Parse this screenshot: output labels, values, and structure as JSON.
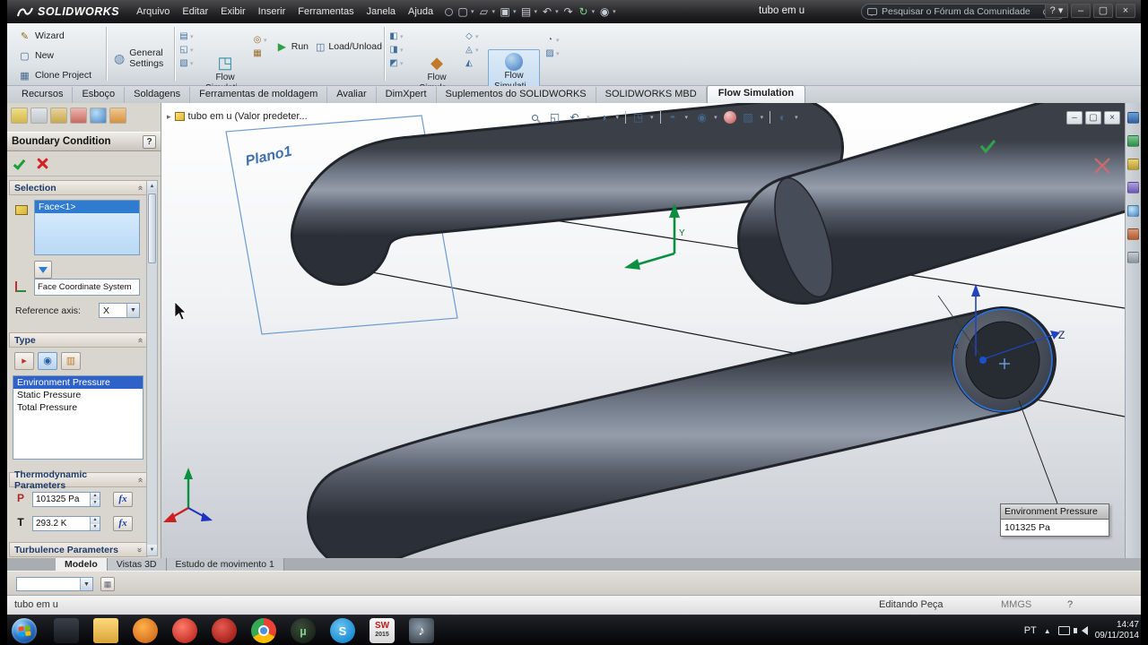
{
  "titlebar": {
    "logo": "SOLIDWORKS",
    "menus": [
      {
        "label": "Arquivo"
      },
      {
        "label": "Editar"
      },
      {
        "label": "Exibir"
      },
      {
        "label": "Inserir"
      },
      {
        "label": "Ferramentas"
      },
      {
        "label": "Janela"
      },
      {
        "label": "Ajuda"
      }
    ],
    "document_title": "tubo em u",
    "search_placeholder": "Pesquisar o Fórum da Comunidade",
    "help_label": "?"
  },
  "ribbon": {
    "wizard": "Wizard",
    "new": "New",
    "clone_project": "Clone Project",
    "general_settings": "General Settings",
    "flow_simulation_project": "Flow Simulati...",
    "run": "Run",
    "load_unload": "Load/Unload",
    "flow_simulation_sources": "Flow Simula...",
    "flow_simulation_conditions": "Flow Simulati..."
  },
  "command_tabs": [
    {
      "label": "Recursos"
    },
    {
      "label": "Esboço"
    },
    {
      "label": "Soldagens"
    },
    {
      "label": "Ferramentas de moldagem"
    },
    {
      "label": "Avaliar"
    },
    {
      "label": "DimXpert"
    },
    {
      "label": "Suplementos do SOLIDWORKS"
    },
    {
      "label": "SOLIDWORKS MBD"
    },
    {
      "label": "Flow Simulation"
    }
  ],
  "property_manager": {
    "title": "Boundary Condition",
    "help": "?",
    "selection": {
      "header": "Selection",
      "selected_face": "Face<1>",
      "coordinate_system": "Face Coordinate System",
      "reference_axis_label": "Reference axis:",
      "reference_axis_value": "X"
    },
    "type": {
      "header": "Type",
      "options": [
        {
          "label": "Environment Pressure"
        },
        {
          "label": "Static Pressure"
        },
        {
          "label": "Total Pressure"
        }
      ]
    },
    "thermodynamic": {
      "header": "Thermodynamic Parameters",
      "pressure_symbol": "P",
      "pressure_value": "101325 Pa",
      "temperature_symbol": "T",
      "temperature_value": "293.2 K",
      "fx_label": "fx"
    },
    "turbulence": {
      "header": "Turbulence Parameters"
    }
  },
  "viewport": {
    "breadcrumb": "tubo em u  (Valor predeter...",
    "plane_label": "Plano1",
    "origin_y_label": "Y",
    "axis_z_label": "Z",
    "axis_x_label": "x",
    "callout": {
      "title": "Environment Pressure",
      "value": "101325 Pa"
    }
  },
  "bottom_tabs": [
    {
      "label": "Modelo"
    },
    {
      "label": "Vistas 3D"
    },
    {
      "label": "Estudo de movimento 1"
    }
  ],
  "status_bar": {
    "document": "tubo em u",
    "mode": "Editando Peça",
    "units": "MMGS",
    "help": "?"
  },
  "taskbar": {
    "language": "PT",
    "time": "14:47",
    "date": "09/11/2014",
    "utorrent_letter": "µ",
    "skype_letter": "S",
    "solidworks_label": "SW",
    "solidworks_year": "2015",
    "itunes_glyph": "♪"
  },
  "colors": {
    "selection_blue": "#2e7bd0",
    "list_selected_blue": "#2e62c8",
    "check_green": "#17a033",
    "cross_red": "#d32222",
    "plane_blue": "#6b9bd2"
  }
}
